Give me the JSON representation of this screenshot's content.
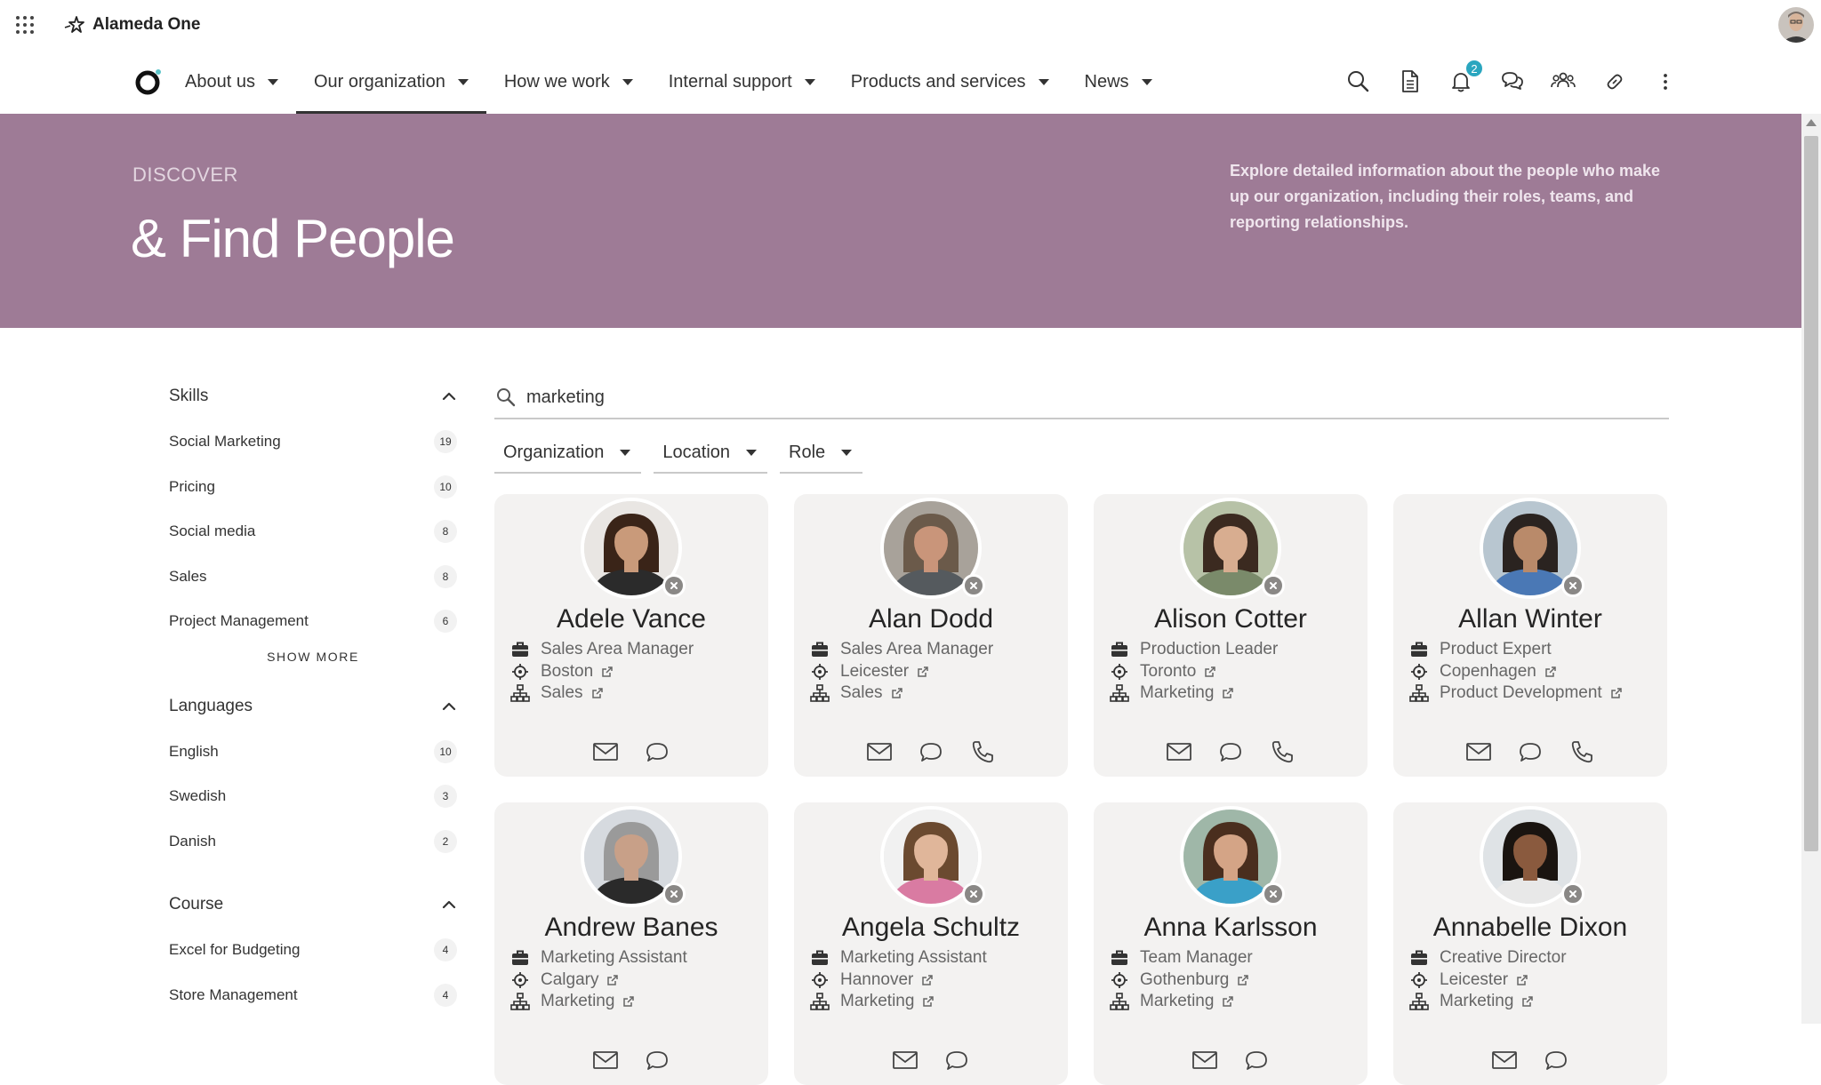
{
  "app": {
    "brand": "Alameda One"
  },
  "nav": {
    "items": [
      {
        "label": "About us",
        "active": false
      },
      {
        "label": "Our organization",
        "active": true
      },
      {
        "label": "How we work",
        "active": false
      },
      {
        "label": "Internal support",
        "active": false
      },
      {
        "label": "Products and services",
        "active": false
      },
      {
        "label": "News",
        "active": false
      }
    ],
    "tools": [
      {
        "icon": "search-icon"
      },
      {
        "icon": "document-icon"
      },
      {
        "icon": "bell-icon",
        "badge": "2"
      },
      {
        "icon": "chat-icon"
      },
      {
        "icon": "people-icon"
      },
      {
        "icon": "link-icon"
      },
      {
        "icon": "more-icon"
      }
    ]
  },
  "hero": {
    "kicker": "DISCOVER",
    "title": "& Find People",
    "description": "Explore detailed information about the people who make up our organization, including their roles, teams, and reporting relationships."
  },
  "sidebar": {
    "show_more": "SHOW MORE",
    "sections": [
      {
        "title": "Skills",
        "items": [
          {
            "label": "Social Marketing",
            "count": "19"
          },
          {
            "label": "Pricing",
            "count": "10"
          },
          {
            "label": "Social media",
            "count": "8"
          },
          {
            "label": "Sales",
            "count": "8"
          },
          {
            "label": "Project Management",
            "count": "6"
          }
        ]
      },
      {
        "title": "Languages",
        "items": [
          {
            "label": "English",
            "count": "10"
          },
          {
            "label": "Swedish",
            "count": "3"
          },
          {
            "label": "Danish",
            "count": "2"
          }
        ]
      },
      {
        "title": "Course",
        "items": [
          {
            "label": "Excel for Budgeting",
            "count": "4"
          },
          {
            "label": "Store Management",
            "count": "4"
          }
        ]
      }
    ]
  },
  "search": {
    "value": "marketing"
  },
  "filters": [
    "Organization",
    "Location",
    "Role"
  ],
  "people": [
    {
      "name": "Adele Vance",
      "title": "Sales Area Manager",
      "location": "Boston",
      "department": "Sales",
      "phone": false,
      "skin": "#c99a7a",
      "hair": "#3a2418",
      "shirt": "#2b2b2b",
      "bg": "#e9e6e3"
    },
    {
      "name": "Alan Dodd",
      "title": "Sales Area Manager",
      "location": "Leicester",
      "department": "Sales",
      "phone": true,
      "skin": "#c9957a",
      "hair": "#6b5a4a",
      "shirt": "#555a5e",
      "bg": "#a8a29a"
    },
    {
      "name": "Alison Cotter",
      "title": "Production Leader",
      "location": "Toronto",
      "department": "Marketing",
      "phone": true,
      "skin": "#d8ad90",
      "hair": "#3b2a20",
      "shirt": "#7a8a6a",
      "bg": "#b7c2a7"
    },
    {
      "name": "Allan Winter",
      "title": "Product Expert",
      "location": "Copenhagen",
      "department": "Product Development",
      "phone": true,
      "skin": "#b98a6a",
      "hair": "#2a2320",
      "shirt": "#4a78b5",
      "bg": "#b8c6d0"
    },
    {
      "name": "Andrew Banes",
      "title": "Marketing Assistant",
      "location": "Calgary",
      "department": "Marketing",
      "phone": false,
      "skin": "#c8a088",
      "hair": "#9a9a9a",
      "shirt": "#2a2a2a",
      "bg": "#d6dadf"
    },
    {
      "name": "Angela Schultz",
      "title": "Marketing Assistant",
      "location": "Hannover",
      "department": "Marketing",
      "phone": false,
      "skin": "#e0b69a",
      "hair": "#6b4a30",
      "shirt": "#d97ba2",
      "bg": "#f1f1f1"
    },
    {
      "name": "Anna Karlsson",
      "title": "Team Manager",
      "location": "Gothenburg",
      "department": "Marketing",
      "phone": false,
      "skin": "#d4a486",
      "hair": "#4a2e1e",
      "shirt": "#3aa0c8",
      "bg": "#9fb7a8"
    },
    {
      "name": "Annabelle Dixon",
      "title": "Creative Director",
      "location": "Leicester",
      "department": "Marketing",
      "phone": false,
      "skin": "#8a5a3e",
      "hair": "#1a1410",
      "shirt": "#e8e8e8",
      "bg": "#dfe3e6"
    }
  ]
}
